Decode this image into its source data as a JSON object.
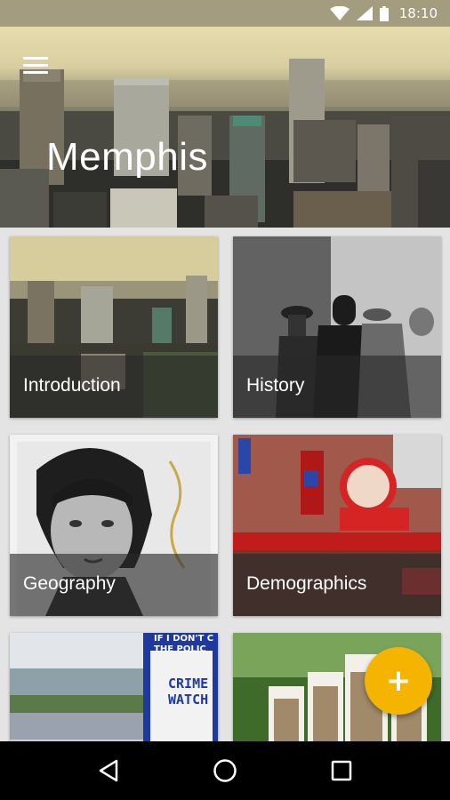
{
  "status_bar": {
    "time": "18:10",
    "icons": [
      "wifi-icon",
      "signal-icon",
      "battery-icon"
    ]
  },
  "header": {
    "title": "Memphis",
    "menu_icon": "hamburger-menu-icon"
  },
  "topics": [
    {
      "label": "Introduction"
    },
    {
      "label": "History"
    },
    {
      "label": "Geography"
    },
    {
      "label": "Demographics"
    },
    {
      "label": ""
    },
    {
      "label": ""
    }
  ],
  "sign_text": {
    "line1": "IF I DON'T C",
    "line2": "THE POLIC",
    "crime1": "CRIME",
    "crime2": "WATCH"
  },
  "fab": {
    "icon": "plus-icon",
    "label": "+"
  },
  "nav": {
    "back": "back-icon",
    "home": "home-icon",
    "recents": "recents-icon"
  },
  "colors": {
    "accent": "#f4b400",
    "status_bar": "#a49c7e",
    "caption_overlay": "#282828"
  }
}
